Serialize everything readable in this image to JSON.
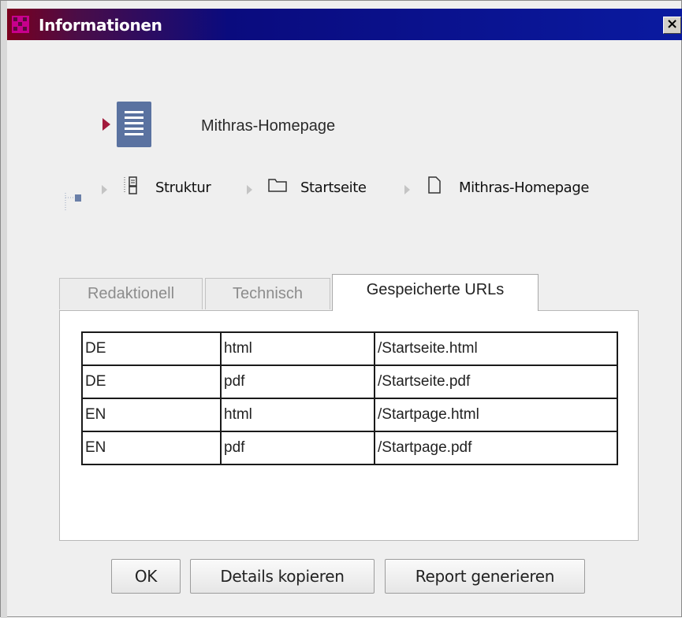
{
  "window": {
    "title": "Informationen",
    "close_glyph": "×"
  },
  "header": {
    "page_name": "Mithras-Homepage"
  },
  "breadcrumb": {
    "items": [
      {
        "label": "Struktur",
        "icon": "structure-icon"
      },
      {
        "label": "Startseite",
        "icon": "folder-icon"
      },
      {
        "label": "Mithras-Homepage",
        "icon": "page-icon"
      }
    ]
  },
  "tabs": [
    {
      "label": "Redaktionell",
      "active": false
    },
    {
      "label": "Technisch",
      "active": false
    },
    {
      "label": "Gespeicherte URLs",
      "active": true
    }
  ],
  "url_table": {
    "rows": [
      [
        "DE",
        "html",
        "/Startseite.html"
      ],
      [
        "DE",
        "pdf",
        "/Startseite.pdf"
      ],
      [
        "EN",
        "html",
        "/Startpage.html"
      ],
      [
        "EN",
        "pdf",
        "/Startpage.pdf"
      ]
    ]
  },
  "buttons": {
    "ok": "OK",
    "copy_details": "Details kopieren",
    "generate_report": "Report generieren"
  },
  "colors": {
    "title_start": "#7a001e",
    "title_end": "#0a1aa0",
    "doc_icon": "#5a72a0",
    "arrow_accent": "#a21a3c"
  }
}
